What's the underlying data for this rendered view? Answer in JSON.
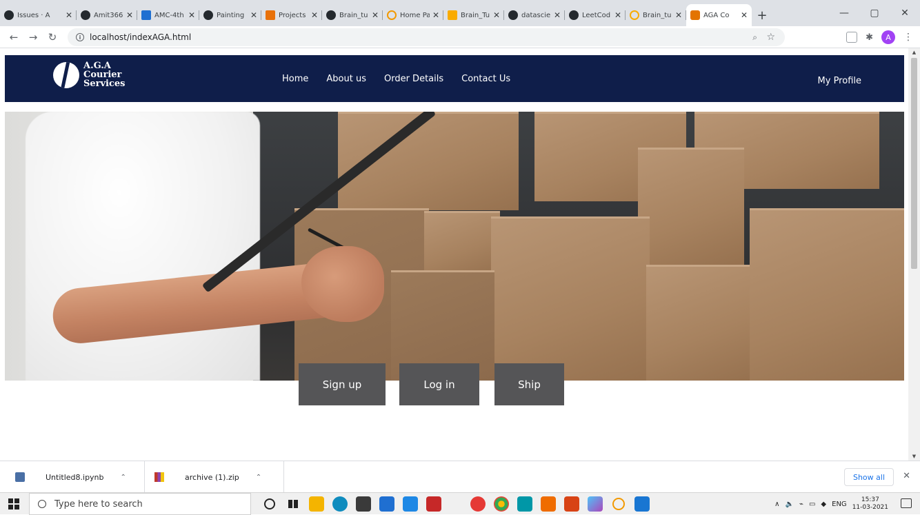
{
  "browser": {
    "tabs": [
      {
        "title": "Issues · A",
        "icon": "github-icon",
        "active": false
      },
      {
        "title": "Amit366",
        "icon": "github-icon",
        "active": false
      },
      {
        "title": "AMC-4th",
        "icon": "kanban-icon",
        "active": false
      },
      {
        "title": "Painting",
        "icon": "github-icon",
        "active": false
      },
      {
        "title": "Projects",
        "icon": "projects-icon",
        "active": false
      },
      {
        "title": "Brain_tu",
        "icon": "github-icon",
        "active": false
      },
      {
        "title": "Home Pa",
        "icon": "loading-icon",
        "active": false
      },
      {
        "title": "Brain_Tu",
        "icon": "pen-icon",
        "active": false
      },
      {
        "title": "datascie",
        "icon": "github-icon",
        "active": false
      },
      {
        "title": "LeetCod",
        "icon": "github-icon",
        "active": false
      },
      {
        "title": "Brain_tu",
        "icon": "colab-icon",
        "active": false
      },
      {
        "title": "AGA Co",
        "icon": "site-icon",
        "active": true
      }
    ],
    "url": "localhost/indexAGA.html",
    "profile_initial": "A"
  },
  "site": {
    "logo_lines": [
      "A.G.A",
      "Courier",
      "Services"
    ],
    "nav": [
      "Home",
      "About us",
      "Order Details",
      "Contact Us"
    ],
    "profile": "My Profile",
    "buttons": {
      "signup": "Sign up",
      "login": "Log in",
      "ship": "Ship"
    }
  },
  "downloads": {
    "items": [
      {
        "name": "Untitled8.ipynb",
        "icon": "notebook-file-icon"
      },
      {
        "name": "archive (1).zip",
        "icon": "zip-file-icon"
      }
    ],
    "show_all": "Show all"
  },
  "taskbar": {
    "search_placeholder": "Type here to search",
    "lang": "ENG",
    "time": "15:37",
    "date": "11-03-2021"
  },
  "colors": {
    "nav_bg": "#0f1e4a",
    "cta_bg": "#555557",
    "link_blue": "#1a73e8"
  }
}
